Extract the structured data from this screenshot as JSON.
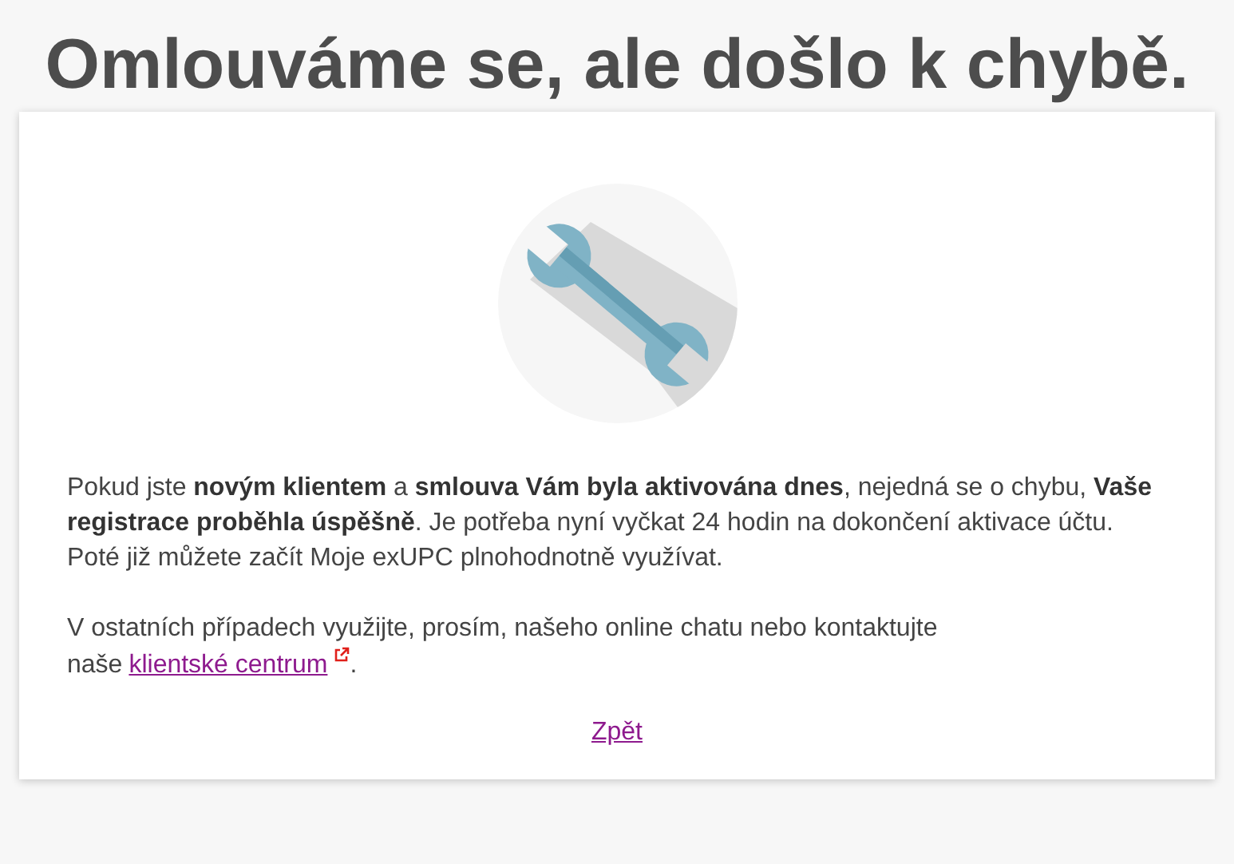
{
  "title": "Omlouváme se, ale došlo k chybě.",
  "paragraphs": [
    {
      "text": "Pokud jste **novým klientem** a **smlouva Vám byla aktivována dnes**, nejedná se o chybu, **Vaše registrace proběhla úspěšně**. Je potřeba nyní vyčkat 24 hodin na dokončení aktivace účtu. Poté již můžete začít Moje exUPC plnohodnotně využívat."
    },
    {
      "text": "V ostatních případech využijte, prosím, našeho online chatu nebo kontaktujte naše",
      "link": "klientské centrum",
      "suffix": "."
    }
  ],
  "back_link": "Zpět"
}
